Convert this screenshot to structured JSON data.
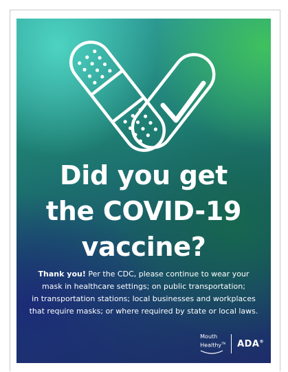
{
  "poster": {
    "headline_line1": "Did you get",
    "headline_line2": "the COVID-19",
    "headline_line3": "vaccine?",
    "thank_you": "Thank you!",
    "body_line1": "Per the CDC, please continue to wear your",
    "body_line2": "mask in healthcare settings; on public transportation;",
    "body_line3": "in transportation stations; local businesses and workplaces",
    "body_line4": "that require masks; or where required by state or local laws."
  },
  "logos": {
    "mouth_healthy_line1": "Mouth",
    "mouth_healthy_line2": "Healthy",
    "mouth_healthy_tm": "TM",
    "ada": "ADA",
    "ada_reg": "®"
  },
  "colors": {
    "teal": "#4fd6c4",
    "green": "#40c45c",
    "navy": "#1d2c6a",
    "text": "#ffffff"
  }
}
